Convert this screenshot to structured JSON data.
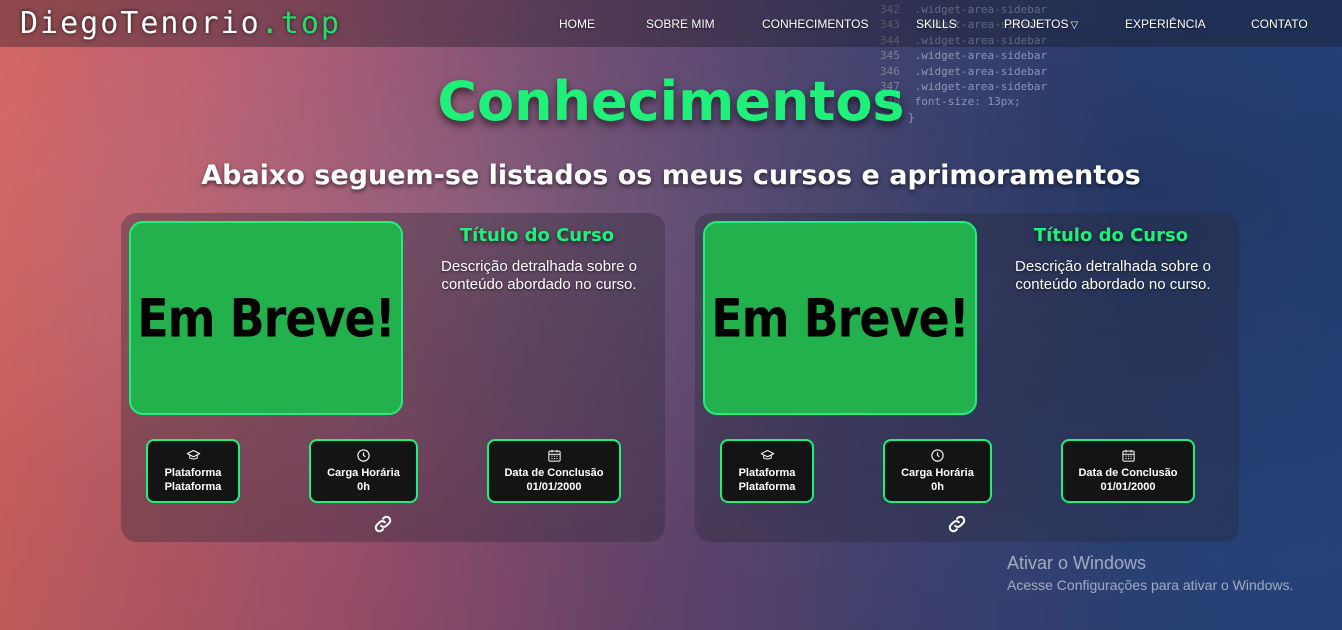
{
  "site": {
    "logo_main": "DiegoTenorio",
    "logo_accent": ".top"
  },
  "nav": [
    {
      "label": "HOME"
    },
    {
      "label": "SOBRE MIM"
    },
    {
      "label": "CONHECIMENTOS"
    },
    {
      "label": "SKILLS"
    },
    {
      "label": "PROJETOS"
    },
    {
      "label": "EXPERIÊNCIA"
    },
    {
      "label": "CONTATO"
    }
  ],
  "nav_dropdown_glyph": "▽",
  "background_code": [
    {
      "num": "342",
      "code": "  .widget-area-sidebar"
    },
    {
      "num": "343",
      "code": "  .widget-area-sidebar"
    },
    {
      "num": "344",
      "code": "  .widget-area-sidebar"
    },
    {
      "num": "345",
      "code": "  .widget-area-sidebar"
    },
    {
      "num": "346",
      "code": "  .widget-area-sidebar"
    },
    {
      "num": "347",
      "code": "  .widget-area-sidebar"
    },
    {
      "num": "348",
      "code": "     font-size: 13px;"
    },
    {
      "num": "349",
      "code": "}"
    }
  ],
  "page": {
    "title": "Conhecimentos",
    "subtitle": "Abaixo seguem-se listados os meus cursos e aprimoramentos"
  },
  "courses": [
    {
      "image_text": "Em Breve!",
      "title": "Título do Curso",
      "description": "Descrição detralhada sobre o conteúdo abordado no curso.",
      "platform_label": "Plataforma",
      "platform_value": "Plataforma",
      "hours_label": "Carga Horária",
      "hours_value": "0h",
      "date_label": "Data de Conclusão",
      "date_value": "01/01/2000"
    },
    {
      "image_text": "Em Breve!",
      "title": "Título do Curso",
      "description": "Descrição detralhada sobre o conteúdo abordado no curso.",
      "platform_label": "Plataforma",
      "platform_value": "Plataforma",
      "hours_label": "Carga Horária",
      "hours_value": "0h",
      "date_label": "Data de Conclusão",
      "date_value": "01/01/2000"
    }
  ],
  "icons": {
    "platform": "graduation-cap-icon",
    "hours": "clock-icon",
    "date": "calendar-icon",
    "link": "link-icon"
  },
  "colors": {
    "accent_green": "#1ef07a",
    "card_image_green": "#22b14c",
    "info_box_bg": "#141414"
  },
  "windows_watermark": {
    "title": "Ativar o Windows",
    "subtitle": "Acesse Configurações para ativar o Windows."
  }
}
